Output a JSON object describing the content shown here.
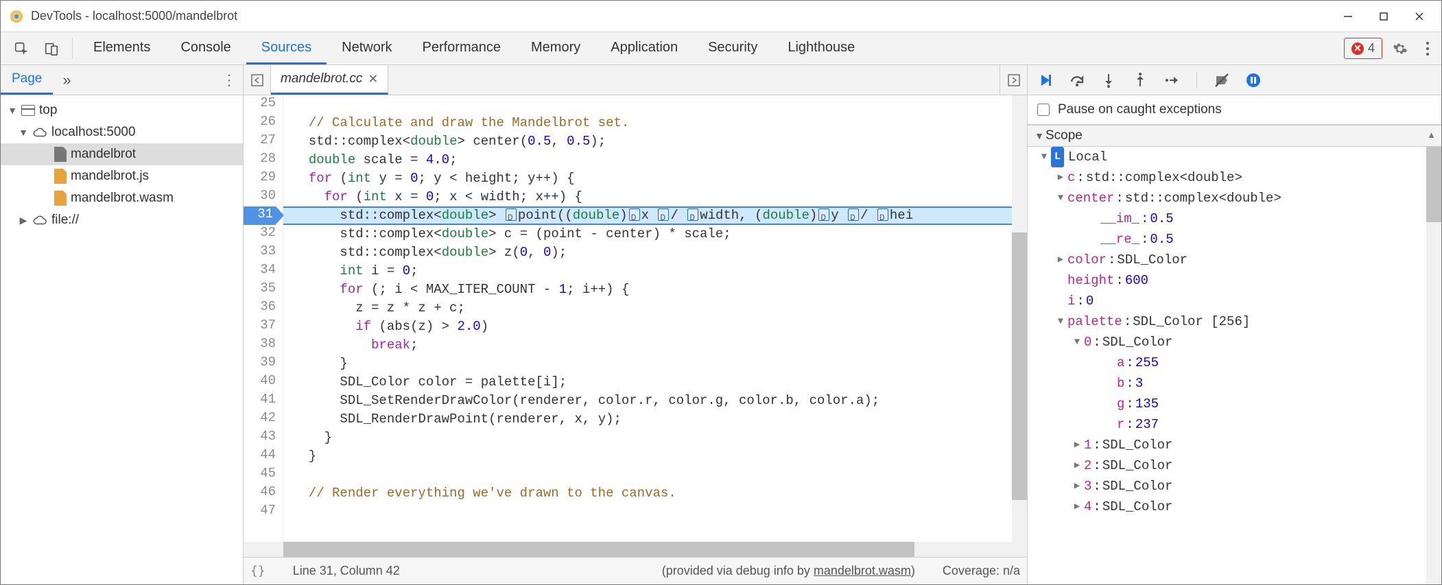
{
  "window": {
    "title": "DevTools - localhost:5000/mandelbrot"
  },
  "mainTabs": {
    "items": [
      "Elements",
      "Console",
      "Sources",
      "Network",
      "Performance",
      "Memory",
      "Application",
      "Security",
      "Lighthouse"
    ],
    "active": "Sources",
    "errorCount": "4"
  },
  "leftPanel": {
    "tab": "Page",
    "tree": {
      "top": "top",
      "host": "localhost:5000",
      "files": [
        "mandelbrot",
        "mandelbrot.js",
        "mandelbrot.wasm"
      ],
      "other": "file://"
    }
  },
  "editor": {
    "filename": "mandelbrot.cc",
    "firstLine": 25,
    "execLine": 31,
    "lines": [
      "",
      "  // Calculate and draw the Mandelbrot set.",
      "  std::complex<double> center(0.5, 0.5);",
      "  double scale = 4.0;",
      "  for (int y = 0; y < height; y++) {",
      "    for (int x = 0; x < width; x++) {",
      "      std::complex<double> [D]point((double)[D]x [D]/ [D]width, (double)[D]y [D]/ [D]hei",
      "      std::complex<double> c = (point - center) * scale;",
      "      std::complex<double> z(0, 0);",
      "      int i = 0;",
      "      for (; i < MAX_ITER_COUNT - 1; i++) {",
      "        z = z * z + c;",
      "        if (abs(z) > 2.0)",
      "          break;",
      "      }",
      "      SDL_Color color = palette[i];",
      "      SDL_SetRenderDrawColor(renderer, color.r, color.g, color.b, color.a);",
      "      SDL_RenderDrawPoint(renderer, x, y);",
      "    }",
      "  }",
      "",
      "  // Render everything we've drawn to the canvas.",
      ""
    ]
  },
  "statusbar": {
    "pretty": "{}",
    "cursor": "Line 31, Column 42",
    "source": "(provided via debug info by ",
    "sourceLink": "mandelbrot.wasm",
    "sourceEnd": ")",
    "coverage": "Coverage: n/a"
  },
  "rightPanel": {
    "pauseOnCaught": "Pause on caught exceptions",
    "scopeHeader": "Scope",
    "local": "Local",
    "vars": {
      "c": {
        "name": "c",
        "type": "std::complex<double>"
      },
      "center": {
        "name": "center",
        "type": "std::complex<double>",
        "im_name": "__im_",
        "im": "0.5",
        "re_name": "__re_",
        "re": "0.5"
      },
      "color": {
        "name": "color",
        "type": "SDL_Color"
      },
      "height": {
        "name": "height",
        "val": "600"
      },
      "i": {
        "name": "i",
        "val": "0"
      },
      "palette": {
        "name": "palette",
        "type": "SDL_Color [256]",
        "entry0": {
          "idx": "0",
          "type": "SDL_Color",
          "a": "255",
          "b": "3",
          "g": "135",
          "r": "237"
        },
        "entries": [
          {
            "idx": "1",
            "type": "SDL_Color"
          },
          {
            "idx": "2",
            "type": "SDL_Color"
          },
          {
            "idx": "3",
            "type": "SDL_Color"
          },
          {
            "idx": "4",
            "type": "SDL_Color"
          }
        ]
      }
    }
  }
}
